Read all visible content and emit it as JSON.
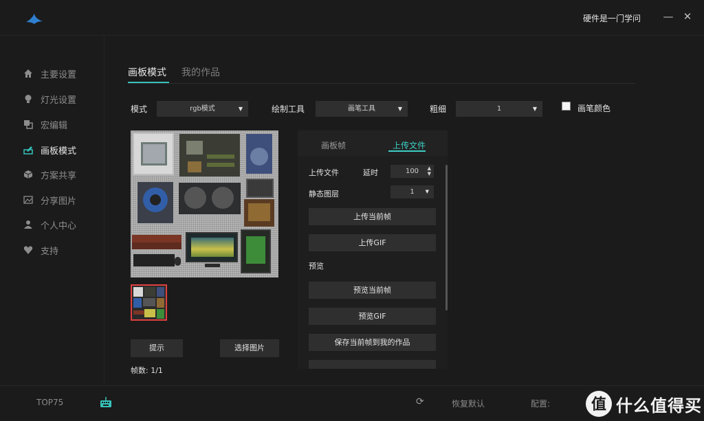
{
  "titlebar": {
    "user": "硬件是一门学问",
    "minimize": "—",
    "close": "✕"
  },
  "sidebar": {
    "items": [
      {
        "label": "主要设置",
        "icon": "home-icon"
      },
      {
        "label": "灯光设置",
        "icon": "bulb-icon"
      },
      {
        "label": "宏编辑",
        "icon": "macro-icon"
      },
      {
        "label": "画板模式",
        "icon": "draw-icon",
        "active": true
      },
      {
        "label": "方案共享",
        "icon": "cube-icon"
      },
      {
        "label": "分享图片",
        "icon": "image-icon"
      },
      {
        "label": "个人中心",
        "icon": "user-icon"
      },
      {
        "label": "支持",
        "icon": "heart-icon"
      }
    ]
  },
  "tabs": [
    {
      "label": "画板模式",
      "active": true
    },
    {
      "label": "我的作品"
    }
  ],
  "toolbar": {
    "mode_label": "模式",
    "mode_value": "rgb模式",
    "tool_label": "绘制工具",
    "tool_value": "画笔工具",
    "size_label": "粗细",
    "size_value": "1",
    "color_label": "画笔颜色"
  },
  "canvas": {
    "thumb_count": 1
  },
  "buttons": {
    "hint": "提示",
    "choose": "选择图片"
  },
  "frames": "帧数: 1/1",
  "panel": {
    "tabs": [
      {
        "label": "画板帧"
      },
      {
        "label": "上传文件",
        "active": true
      }
    ],
    "upload_label": "上传文件",
    "delay_label": "延时",
    "delay_value": "100",
    "layer_label": "静态图层",
    "layer_value": "1",
    "upload_current": "上传当前帧",
    "upload_gif": "上传GIF",
    "preview_label": "预览",
    "preview_current": "预览当前帧",
    "preview_gif": "预览GIF",
    "save_current": "保存当前帧到我的作品"
  },
  "footer": {
    "device": "TOP75",
    "restore": "恢复默认",
    "config_label": "配置:",
    "watermark": "什么值得买"
  },
  "colors": {
    "accent": "#36c2bb",
    "background": "#1b1b1b",
    "button": "#2f2f2f",
    "thumb_border": "#e04040"
  }
}
